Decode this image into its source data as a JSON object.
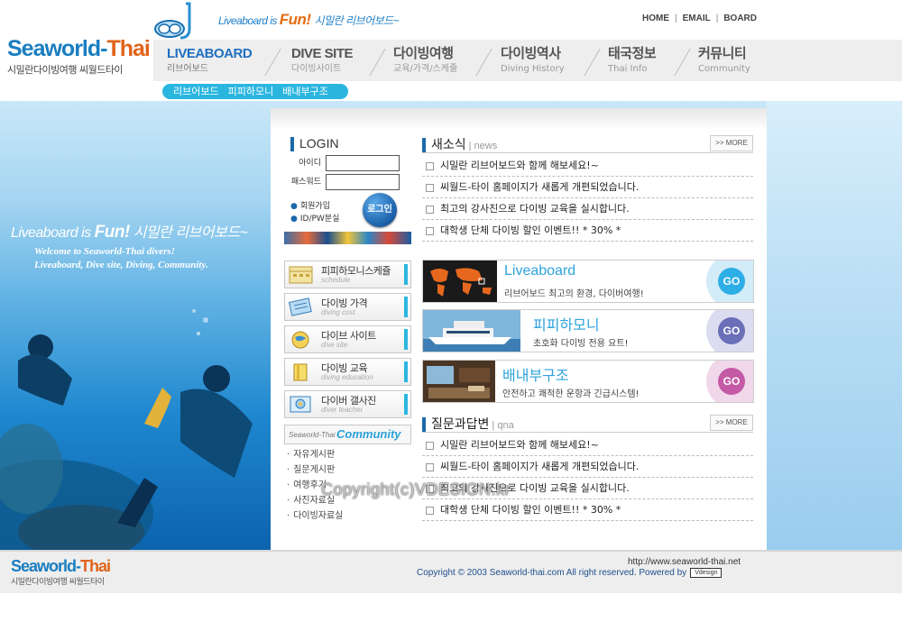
{
  "logo": {
    "text_sea": "Seaworld-",
    "text_thai": "Thai",
    "subtitle": "시밀란다이빙여행 씨월드타이"
  },
  "tagline": {
    "prefix": "Liveaboard is ",
    "fun": "Fun!",
    "korean": "시밀란 리브어보드~"
  },
  "topnav": {
    "items": [
      "HOME",
      "EMAIL",
      "BOARD"
    ]
  },
  "gnb": {
    "items": [
      {
        "main": "LIVEABOARD",
        "sub": "리브어보드",
        "active": true
      },
      {
        "main": "DIVE SITE",
        "sub": "다이빙사이트"
      },
      {
        "main": "다이빙여행",
        "sub": "교육/가격/스케쥴"
      },
      {
        "main": "다이빙역사",
        "sub": "Diving History"
      },
      {
        "main": "태국정보",
        "sub": "Thai Info"
      },
      {
        "main": "커뮤니티",
        "sub": "Community"
      }
    ]
  },
  "subnav": {
    "items": [
      "리브어보드",
      "피피하모니",
      "배내부구조"
    ]
  },
  "hero": {
    "prefix": "Liveaboard is ",
    "fun": "Fun!",
    "korean": "시밀란 리브어보드~",
    "welcome1": "Welcome to Seaworld-Thai divers!",
    "welcome2": "Liveaboard, Dive site, Diving, Community."
  },
  "login": {
    "title": "LOGIN",
    "id_label": "아이디",
    "pw_label": "패스워드",
    "id_value": "",
    "pw_value": "",
    "join": "회원가입",
    "find": "ID/PW분실",
    "button": "로그인"
  },
  "left_menu": [
    {
      "title": "피피하모니스케쥴",
      "sub": "schedule",
      "icon": "calendar-icon",
      "color": "#e9d27a"
    },
    {
      "title": "다이빙 가격",
      "sub": "diving cost",
      "icon": "price-icon",
      "color": "#7ab8e6"
    },
    {
      "title": "다이브 사이트",
      "sub": "dive site",
      "icon": "globe-icon",
      "color": "#f0c84a"
    },
    {
      "title": "다이빙 교육",
      "sub": "diving education",
      "icon": "book-icon",
      "color": "#f2d45a"
    },
    {
      "title": "다이버 갤사진",
      "sub": "diver teacher",
      "icon": "photo-icon",
      "color": "#8fc4ea"
    }
  ],
  "community": {
    "prefix": "Seaworld-Thai",
    "title": "Community",
    "items": [
      "자유게시판",
      "질문게시판",
      "여행후기",
      "사진자료실",
      "다이빙자료실"
    ]
  },
  "news": {
    "title": "새소식",
    "en": "news",
    "more": "MORE",
    "items": [
      "시밀란 리브어보드와 함께 해보세요!~",
      "씨월드-타이 홈페이지가 새롭게 개편되었습니다.",
      "최고의 강사진으로 다이빙 교육을 실시합니다.",
      "대학생 단체 다이빙 할인 이벤트!! * 30% *"
    ]
  },
  "banners": [
    {
      "title": "Liveaboard",
      "desc": "리브어보드 최고의 환경, 다이버여행!",
      "go": "GO",
      "go_color": "#2eaee6",
      "bg_color": "#d2ecf8"
    },
    {
      "title": "피피하모니",
      "desc": "초호화 다이빙 전용 요트!",
      "go": "GO",
      "go_color": "#6a6fb8",
      "bg_color": "#dcdcf0"
    },
    {
      "title": "배내부구조",
      "desc": "안전하고 쾌적한 운항과 긴급시스템!",
      "go": "GO",
      "go_color": "#c45aa6",
      "bg_color": "#f0d8ea"
    }
  ],
  "qna": {
    "title": "질문과답변",
    "en": "qna",
    "more": "MORE",
    "items": [
      "시밀란 리브어보드와 함께 해보세요!~",
      "씨월드-타이 홈페이지가 새롭게 개편되었습니다.",
      "최고의 강사진으로 다이빙 교육을 실시합니다.",
      "대학생 단체 다이빙 할인 이벤트!! * 30% *"
    ]
  },
  "watermark": "Copyright(c)VDESIGN.kr",
  "footer": {
    "logo_sea": "Seaworld-",
    "logo_thai": "Thai",
    "logo_sub": "시밀란다이빙여행 씨월드타이",
    "url": "http://www.seaworld-thai.net",
    "copyright": "Copyright © 2003 Seaworld-thai.com All right reserved. Powered by",
    "badge": "Vdesign"
  },
  "colors": {
    "accent": "#1f6fc0",
    "cyan": "#2bb6e0",
    "orange": "#e66c13"
  }
}
